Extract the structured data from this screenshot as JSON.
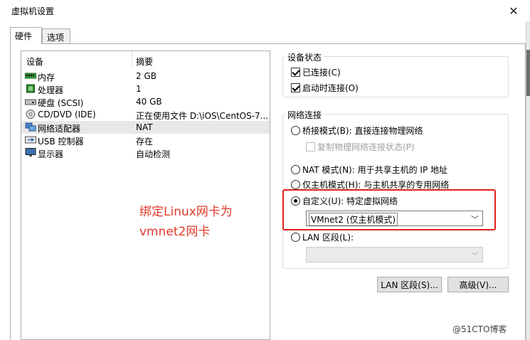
{
  "window": {
    "title": "虚拟机设置",
    "close_glyph": "✕"
  },
  "tabs": [
    {
      "label": "硬件",
      "active": true
    },
    {
      "label": "选项",
      "active": false
    }
  ],
  "device_list": {
    "col_device": "设备",
    "col_summary": "摘要",
    "rows": [
      {
        "name": "内存",
        "summary": "2 GB",
        "icon": "memory-icon",
        "selected": false
      },
      {
        "name": "处理器",
        "summary": "1",
        "icon": "processor-icon",
        "selected": false
      },
      {
        "name": "硬盘 (SCSI)",
        "summary": "40 GB",
        "icon": "hard-disk-icon",
        "selected": false
      },
      {
        "name": "CD/DVD (IDE)",
        "summary": "正在使用文件 D:\\iOS\\CentOS-7...",
        "icon": "cd-dvd-icon",
        "selected": false
      },
      {
        "name": "网络适配器",
        "summary": "NAT",
        "icon": "network-adapter-icon",
        "selected": true
      },
      {
        "name": "USB 控制器",
        "summary": "存在",
        "icon": "usb-icon",
        "selected": false
      },
      {
        "name": "显示器",
        "summary": "自动检测",
        "icon": "display-icon",
        "selected": false
      }
    ]
  },
  "device_status": {
    "title": "设备状态",
    "connected": {
      "label": "已连接(C)",
      "checked": true
    },
    "connect_on_start": {
      "label": "启动时连接(O)",
      "checked": true
    }
  },
  "network": {
    "title": "网络连接",
    "bridged": {
      "label": "桥接模式(B): 直接连接物理网络",
      "selected": false
    },
    "replicate": {
      "label": "复制物理网络连接状态(P)",
      "checked": false
    },
    "nat": {
      "label": "NAT 模式(N): 用于共享主机的 IP 地址",
      "selected": false
    },
    "host_only": {
      "label": "仅主机模式(H): 与主机共享的专用网络",
      "selected": false
    },
    "custom": {
      "label": "自定义(U): 特定虚拟网络",
      "selected": true
    },
    "custom_select": "VMnet2 (仅主机模式)",
    "lan_segment": {
      "label": "LAN 区段(L):",
      "selected": false
    },
    "lan_select": ""
  },
  "buttons": {
    "lan_segments": "LAN 区段(S)...",
    "advanced": "高级(V)..."
  },
  "annotation": {
    "line1": "绑定Linux网卡为",
    "line2": "vmnet2网卡",
    "color": "#e03a2a",
    "box_color": "#e0201d"
  },
  "watermark": "@51CTO博客",
  "colors": {
    "selected_row": "#e8e8e8",
    "button_bg": "#e1e1e1"
  }
}
